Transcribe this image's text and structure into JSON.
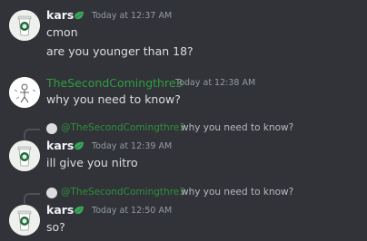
{
  "messages": [
    {
      "author": "kars",
      "timestamp": "Today at 12:37 AM",
      "lines": [
        "cmon",
        "are you younger than 18?"
      ]
    },
    {
      "author": "TheSecondComingthre3",
      "timestamp": "Today at 12:38 AM",
      "lines": [
        "why you need to know?"
      ]
    },
    {
      "reply": {
        "mention": "@TheSecondComingthre3",
        "text": "why you need to know?"
      },
      "author": "kars",
      "timestamp": "Today at 12:39 AM",
      "lines": [
        "ill give you nitro"
      ]
    },
    {
      "reply": {
        "mention": "@TheSecondComingthre3",
        "text": "why you need to know?"
      },
      "author": "kars",
      "timestamp": "Today at 12:50 AM",
      "lines": [
        "so?"
      ]
    }
  ],
  "colors": {
    "background": "#313338",
    "username_kars": "#f2f3f5",
    "username_other": "#2f9e3f",
    "badge": "#3ba55c",
    "timestamp": "#949ba4",
    "message_text": "#dbdee1"
  },
  "icons": {
    "avatar_kars": "starbucks-cup-avatar",
    "avatar_other": "sketch-avatar",
    "badge": "green-leaf-badge",
    "reply": "reply-avatar-icon"
  }
}
